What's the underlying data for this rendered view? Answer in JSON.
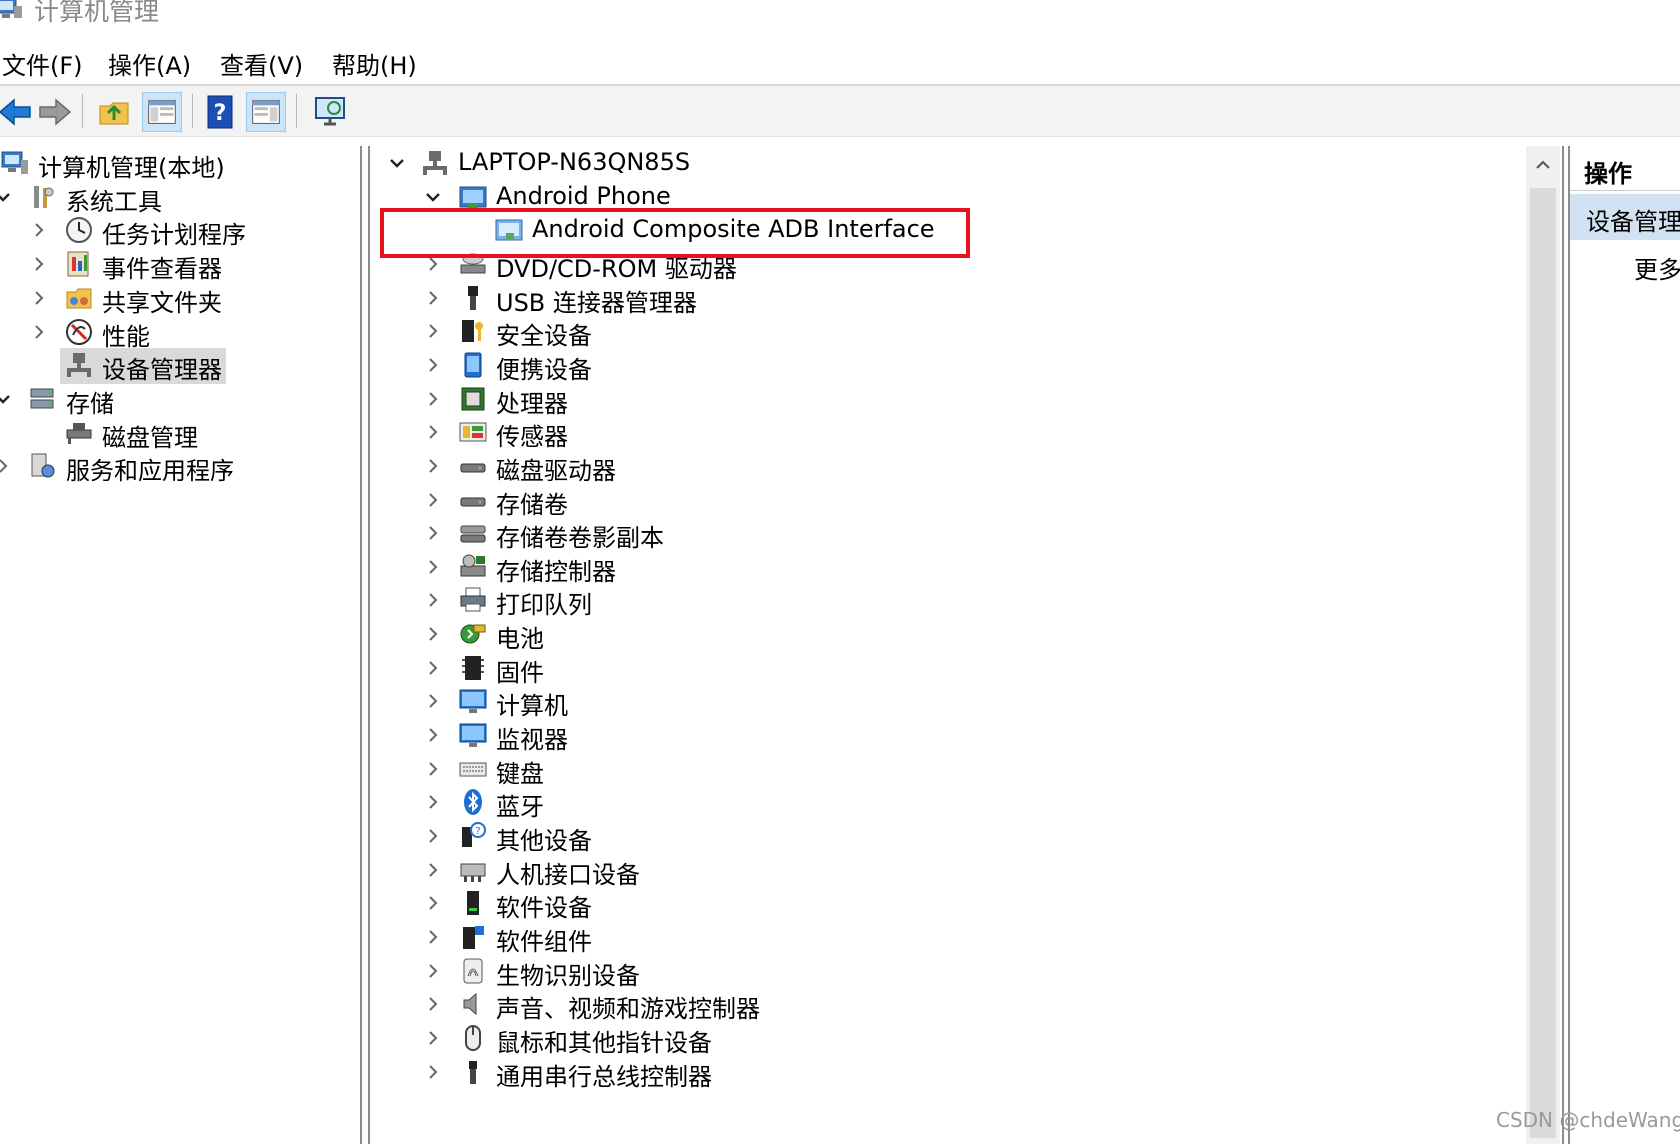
{
  "window": {
    "title": "计算机管理"
  },
  "menu": {
    "items": [
      "文件(F)",
      "操作(A)",
      "查看(V)",
      "帮助(H)"
    ]
  },
  "toolbar": {
    "buttons": [
      {
        "icon": "back-arrow-icon"
      },
      {
        "icon": "forward-arrow-icon"
      },
      {
        "icon": "up-folder-icon"
      },
      {
        "icon": "show-hide-console-tree-icon"
      },
      {
        "icon": "help-icon"
      },
      {
        "icon": "show-hide-action-pane-icon"
      },
      {
        "icon": "monitor-icon"
      }
    ]
  },
  "tree": {
    "items": [
      {
        "label": "计算机管理(本地)",
        "icon": "computer-management-icon",
        "expander": "none",
        "level": 0
      },
      {
        "label": "系统工具",
        "icon": "system-tools-icon",
        "expander": "expanded",
        "level": 1
      },
      {
        "label": "任务计划程序",
        "icon": "clock-icon",
        "expander": "collapsed",
        "level": 2
      },
      {
        "label": "事件查看器",
        "icon": "event-viewer-icon",
        "expander": "collapsed",
        "level": 2
      },
      {
        "label": "共享文件夹",
        "icon": "shared-folder-icon",
        "expander": "collapsed",
        "level": 2
      },
      {
        "label": "性能",
        "icon": "performance-icon",
        "expander": "collapsed",
        "level": 2
      },
      {
        "label": "设备管理器",
        "icon": "device-manager-icon",
        "expander": "none",
        "level": 2,
        "selected": true
      },
      {
        "label": "存储",
        "icon": "storage-icon",
        "expander": "expanded",
        "level": 1
      },
      {
        "label": "磁盘管理",
        "icon": "disk-management-icon",
        "expander": "none",
        "level": 2
      },
      {
        "label": "服务和应用程序",
        "icon": "services-icon",
        "expander": "collapsed",
        "level": 1
      }
    ]
  },
  "devices": {
    "root": {
      "label": "LAPTOP-N63QN85S",
      "icon": "computer-network-icon"
    },
    "items": [
      {
        "label": "Android Phone",
        "icon": "android-phone-icon",
        "expander": "expanded",
        "level": 1
      },
      {
        "label": "Android Composite ADB Interface",
        "icon": "adb-interface-icon",
        "expander": "none",
        "level": 2,
        "highlighted": true
      },
      {
        "label": "DVD/CD-ROM 驱动器",
        "icon": "dvd-drive-icon",
        "expander": "collapsed",
        "level": 1
      },
      {
        "label": "USB 连接器管理器",
        "icon": "usb-icon",
        "expander": "collapsed",
        "level": 1
      },
      {
        "label": "安全设备",
        "icon": "security-device-icon",
        "expander": "collapsed",
        "level": 1
      },
      {
        "label": "便携设备",
        "icon": "portable-device-icon",
        "expander": "collapsed",
        "level": 1
      },
      {
        "label": "处理器",
        "icon": "processor-icon",
        "expander": "collapsed",
        "level": 1
      },
      {
        "label": "传感器",
        "icon": "sensor-icon",
        "expander": "collapsed",
        "level": 1
      },
      {
        "label": "磁盘驱动器",
        "icon": "disk-drive-icon",
        "expander": "collapsed",
        "level": 1
      },
      {
        "label": "存储卷",
        "icon": "storage-volume-icon",
        "expander": "collapsed",
        "level": 1
      },
      {
        "label": "存储卷卷影副本",
        "icon": "shadow-copy-icon",
        "expander": "collapsed",
        "level": 1
      },
      {
        "label": "存储控制器",
        "icon": "storage-controller-icon",
        "expander": "collapsed",
        "level": 1
      },
      {
        "label": "打印队列",
        "icon": "printer-icon",
        "expander": "collapsed",
        "level": 1
      },
      {
        "label": "电池",
        "icon": "battery-icon",
        "expander": "collapsed",
        "level": 1
      },
      {
        "label": "固件",
        "icon": "firmware-icon",
        "expander": "collapsed",
        "level": 1
      },
      {
        "label": "计算机",
        "icon": "computer-icon",
        "expander": "collapsed",
        "level": 1
      },
      {
        "label": "监视器",
        "icon": "monitor-icon",
        "expander": "collapsed",
        "level": 1
      },
      {
        "label": "键盘",
        "icon": "keyboard-icon",
        "expander": "collapsed",
        "level": 1
      },
      {
        "label": "蓝牙",
        "icon": "bluetooth-icon",
        "expander": "collapsed",
        "level": 1
      },
      {
        "label": "其他设备",
        "icon": "other-devices-icon",
        "expander": "collapsed",
        "level": 1
      },
      {
        "label": "人机接口设备",
        "icon": "hid-icon",
        "expander": "collapsed",
        "level": 1
      },
      {
        "label": "软件设备",
        "icon": "software-device-icon",
        "expander": "collapsed",
        "level": 1
      },
      {
        "label": "软件组件",
        "icon": "software-component-icon",
        "expander": "collapsed",
        "level": 1
      },
      {
        "label": "生物识别设备",
        "icon": "biometric-icon",
        "expander": "collapsed",
        "level": 1
      },
      {
        "label": "声音、视频和游戏控制器",
        "icon": "speaker-icon",
        "expander": "collapsed",
        "level": 1
      },
      {
        "label": "鼠标和其他指针设备",
        "icon": "mouse-icon",
        "expander": "collapsed",
        "level": 1
      },
      {
        "label": "通用串行总线控制器",
        "icon": "usb-controller-icon",
        "expander": "collapsed",
        "level": 1
      }
    ]
  },
  "actions": {
    "title": "操作",
    "section": "设备管理器",
    "more": "更多操作"
  },
  "watermark": "CSDN @chdeWang",
  "colors": {
    "highlight_box": "#e8111e",
    "selection": "#d9d9d9",
    "actions_section": "#d3e2f2"
  }
}
